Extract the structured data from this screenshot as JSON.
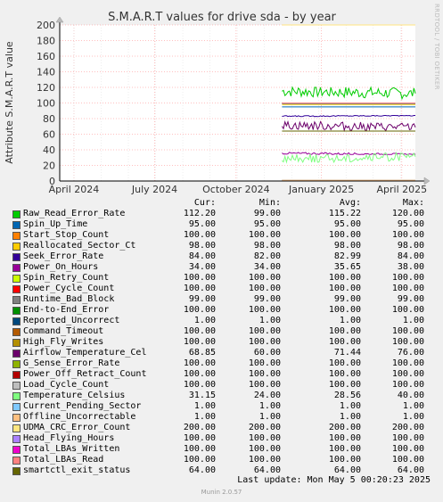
{
  "title": "S.M.A.R.T values for drive sda - by year",
  "ylabel": "Attribute S.M.A.R.T value",
  "rrd_credit": "RRDTOOL / TOBI OETIKER",
  "columns": {
    "cur": "Cur:",
    "min": "Min:",
    "avg": "Avg:",
    "max": "Max:"
  },
  "footer": {
    "last_update": "Last update: Mon May  5 00:20:23 2025",
    "munin": "Munin 2.0.57"
  },
  "chart_data": {
    "type": "line",
    "title": "S.M.A.R.T values for drive sda - by year",
    "xlabel": "",
    "ylabel": "Attribute S.M.A.R.T value",
    "ylim": [
      0,
      200
    ],
    "yticks": [
      0,
      20,
      40,
      60,
      80,
      100,
      120,
      140,
      160,
      180,
      200
    ],
    "x_ticks": [
      "April 2024",
      "July 2024",
      "October 2024",
      "January 2025",
      "April 2025"
    ],
    "grid": true,
    "series": [
      {
        "name": "Raw_Read_Error_Rate",
        "color": "#00cc00",
        "cur": "112.20",
        "min": "99.00",
        "avg": "115.22",
        "max": "120.00"
      },
      {
        "name": "Spin_Up_Time",
        "color": "#0066b3",
        "cur": "95.00",
        "min": "95.00",
        "avg": "95.00",
        "max": "95.00"
      },
      {
        "name": "Start_Stop_Count",
        "color": "#ff8000",
        "cur": "100.00",
        "min": "100.00",
        "avg": "100.00",
        "max": "100.00"
      },
      {
        "name": "Reallocated_Sector_Ct",
        "color": "#ffcc00",
        "cur": "98.00",
        "min": "98.00",
        "avg": "98.00",
        "max": "98.00"
      },
      {
        "name": "Seek_Error_Rate",
        "color": "#330099",
        "cur": "84.00",
        "min": "82.00",
        "avg": "82.99",
        "max": "84.00"
      },
      {
        "name": "Power_On_Hours",
        "color": "#990099",
        "cur": "34.00",
        "min": "34.00",
        "avg": "35.65",
        "max": "38.00"
      },
      {
        "name": "Spin_Retry_Count",
        "color": "#ccff00",
        "cur": "100.00",
        "min": "100.00",
        "avg": "100.00",
        "max": "100.00"
      },
      {
        "name": "Power_Cycle_Count",
        "color": "#ff0000",
        "cur": "100.00",
        "min": "100.00",
        "avg": "100.00",
        "max": "100.00"
      },
      {
        "name": "Runtime_Bad_Block",
        "color": "#808080",
        "cur": "99.00",
        "min": "99.00",
        "avg": "99.00",
        "max": "99.00"
      },
      {
        "name": "End-to-End_Error",
        "color": "#008f00",
        "cur": "100.00",
        "min": "100.00",
        "avg": "100.00",
        "max": "100.00"
      },
      {
        "name": "Reported_Uncorrect",
        "color": "#00487d",
        "cur": "1.00",
        "min": "1.00",
        "avg": "1.00",
        "max": "1.00"
      },
      {
        "name": "Command_Timeout",
        "color": "#b35a00",
        "cur": "100.00",
        "min": "100.00",
        "avg": "100.00",
        "max": "100.00"
      },
      {
        "name": "High_Fly_Writes",
        "color": "#b38f00",
        "cur": "100.00",
        "min": "100.00",
        "avg": "100.00",
        "max": "100.00"
      },
      {
        "name": "Airflow_Temperature_Cel",
        "color": "#6b006b",
        "cur": "68.85",
        "min": "60.00",
        "avg": "71.44",
        "max": "76.00"
      },
      {
        "name": "G_Sense_Error_Rate",
        "color": "#8fb300",
        "cur": "100.00",
        "min": "100.00",
        "avg": "100.00",
        "max": "100.00"
      },
      {
        "name": "Power_Off_Retract_Count",
        "color": "#b30000",
        "cur": "100.00",
        "min": "100.00",
        "avg": "100.00",
        "max": "100.00"
      },
      {
        "name": "Load_Cycle_Count",
        "color": "#bebebe",
        "cur": "100.00",
        "min": "100.00",
        "avg": "100.00",
        "max": "100.00"
      },
      {
        "name": "Temperature_Celsius",
        "color": "#80ff80",
        "cur": "31.15",
        "min": "24.00",
        "avg": "28.56",
        "max": "40.00"
      },
      {
        "name": "Current_Pending_Sector",
        "color": "#80c9ff",
        "cur": "1.00",
        "min": "1.00",
        "avg": "1.00",
        "max": "1.00"
      },
      {
        "name": "Offline_Uncorrectable",
        "color": "#ffc080",
        "cur": "1.00",
        "min": "1.00",
        "avg": "1.00",
        "max": "1.00"
      },
      {
        "name": "UDMA_CRC_Error_Count",
        "color": "#ffe680",
        "cur": "200.00",
        "min": "200.00",
        "avg": "200.00",
        "max": "200.00"
      },
      {
        "name": "Head_Flying_Hours",
        "color": "#aa80ff",
        "cur": "100.00",
        "min": "100.00",
        "avg": "100.00",
        "max": "100.00"
      },
      {
        "name": "Total_LBAs_Written",
        "color": "#ee00cc",
        "cur": "100.00",
        "min": "100.00",
        "avg": "100.00",
        "max": "100.00"
      },
      {
        "name": "Total_LBAs_Read",
        "color": "#ff8080",
        "cur": "100.00",
        "min": "100.00",
        "avg": "100.00",
        "max": "100.00"
      },
      {
        "name": "smartctl_exit_status",
        "color": "#666600",
        "cur": "64.00",
        "min": "64.00",
        "avg": "64.00",
        "max": "64.00"
      }
    ]
  }
}
